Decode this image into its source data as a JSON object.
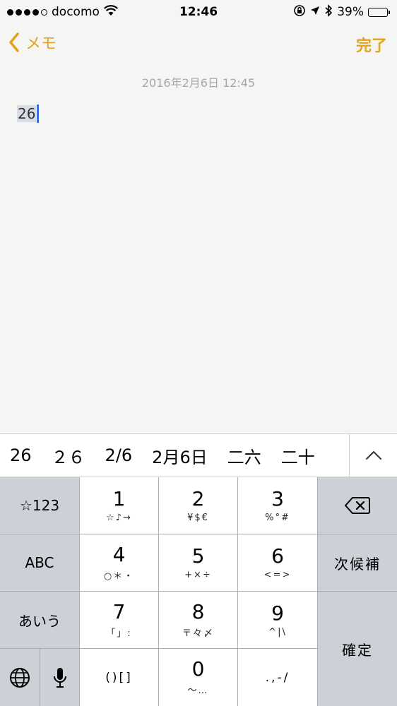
{
  "status": {
    "carrier": "docomo",
    "time": "12:46",
    "battery": "39%",
    "battery_level": 0.39,
    "signal_bars": 4
  },
  "nav": {
    "back_label": "メモ",
    "done_label": "完了"
  },
  "note": {
    "date": "2016年2月6日 12:45",
    "text": "26"
  },
  "candidates": [
    "26",
    "２６",
    "2/6",
    "2月6日",
    "二六",
    "二十"
  ],
  "keyboard": {
    "left": [
      "☆123",
      "ABC",
      "あいう"
    ],
    "numbers": [
      {
        "main": "1",
        "sub": "☆♪→"
      },
      {
        "main": "2",
        "sub": "¥$€"
      },
      {
        "main": "3",
        "sub": "%°#"
      },
      {
        "main": "4",
        "sub": "○＊・"
      },
      {
        "main": "5",
        "sub": "+×÷"
      },
      {
        "main": "6",
        "sub": "<=>"
      },
      {
        "main": "7",
        "sub": "「」:"
      },
      {
        "main": "8",
        "sub": "〒々〆"
      },
      {
        "main": "9",
        "sub": "^|\\"
      },
      {
        "main": "0",
        "sub": "〜…"
      }
    ],
    "brackets": "()[]",
    "punct": ".,-/",
    "right": {
      "candidates": "次候補",
      "confirm": "確定"
    }
  },
  "colors": {
    "accent": "#e3a41c",
    "caret": "#3d6cde"
  }
}
